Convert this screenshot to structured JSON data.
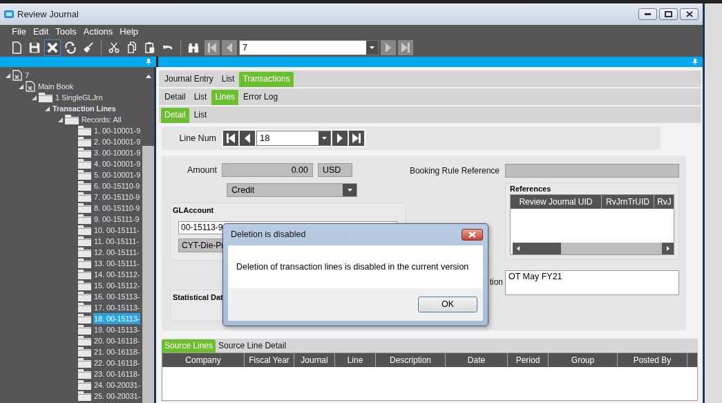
{
  "window": {
    "title": "Review Journal"
  },
  "menu": [
    "File",
    "Edit",
    "Tools",
    "Actions",
    "Help"
  ],
  "toolbar": {
    "buttons": [
      {
        "kind": "new",
        "highlighted": false
      },
      {
        "kind": "save",
        "highlighted": false
      },
      {
        "kind": "delete",
        "highlighted": true
      },
      {
        "kind": "refresh",
        "highlighted": false
      },
      {
        "kind": "clear",
        "highlighted": false
      },
      {
        "kind": "cut",
        "highlighted": false
      },
      {
        "kind": "copy",
        "highlighted": false
      },
      {
        "kind": "paste",
        "highlighted": false
      },
      {
        "kind": "undo",
        "highlighted": false
      },
      {
        "kind": "find",
        "highlighted": false
      }
    ],
    "record_nav": {
      "value": "7",
      "buttons": [
        {
          "kind": "first",
          "disabled": true
        },
        {
          "kind": "prev",
          "disabled": true
        },
        {
          "kind": "next",
          "disabled": true
        },
        {
          "kind": "last",
          "disabled": true
        }
      ]
    }
  },
  "tree": [
    {
      "label": "7",
      "kind": "document",
      "selected": false,
      "children": [
        {
          "label": "Main Book",
          "kind": "document",
          "selected": false,
          "children": [
            {
              "label": "1 SingleGLJrn",
              "kind": "folder",
              "selected": false,
              "children": [
                {
                  "label": "Transaction Lines",
                  "kind": "group",
                  "selected": false,
                  "children": [
                    {
                      "label": "Records: All",
                      "kind": "folder",
                      "selected": false,
                      "children": [
                        {
                          "label": "1. 00-10001-9",
                          "kind": "record",
                          "selected": false
                        },
                        {
                          "label": "2. 00-10001-9",
                          "kind": "record",
                          "selected": false
                        },
                        {
                          "label": "3. 00-10001-9",
                          "kind": "record",
                          "selected": false
                        },
                        {
                          "label": "4. 00-10001-9",
                          "kind": "record",
                          "selected": false
                        },
                        {
                          "label": "5. 00-10001-9",
                          "kind": "record",
                          "selected": false
                        },
                        {
                          "label": "6. 00-15110-9",
                          "kind": "record",
                          "selected": false
                        },
                        {
                          "label": "7. 00-15110-9",
                          "kind": "record",
                          "selected": false
                        },
                        {
                          "label": "8. 00-15110-9",
                          "kind": "record",
                          "selected": false
                        },
                        {
                          "label": "9. 00-15111-9",
                          "kind": "record",
                          "selected": false
                        },
                        {
                          "label": "10. 00-15111-",
                          "kind": "record",
                          "selected": false
                        },
                        {
                          "label": "11. 00-15111-",
                          "kind": "record",
                          "selected": false
                        },
                        {
                          "label": "12. 00-15111-",
                          "kind": "record",
                          "selected": false
                        },
                        {
                          "label": "13. 00-15111-",
                          "kind": "record",
                          "selected": false
                        },
                        {
                          "label": "14. 00-15112-",
                          "kind": "record",
                          "selected": false
                        },
                        {
                          "label": "15. 00-15112-",
                          "kind": "record",
                          "selected": false
                        },
                        {
                          "label": "16. 00-15113-",
                          "kind": "record",
                          "selected": false
                        },
                        {
                          "label": "17. 00-15113-",
                          "kind": "record",
                          "selected": false
                        },
                        {
                          "label": "18. 00-15113-",
                          "kind": "record",
                          "selected": true
                        },
                        {
                          "label": "19. 00-15113-",
                          "kind": "record",
                          "selected": false
                        },
                        {
                          "label": "20. 00-16118-",
                          "kind": "record",
                          "selected": false
                        },
                        {
                          "label": "21. 00-16118-",
                          "kind": "record",
                          "selected": false
                        },
                        {
                          "label": "22. 00-16118-",
                          "kind": "record",
                          "selected": false
                        },
                        {
                          "label": "23. 00-16118-",
                          "kind": "record",
                          "selected": false
                        },
                        {
                          "label": "24. 00-20031-",
                          "kind": "record",
                          "selected": false
                        },
                        {
                          "label": "25. 00-20031-",
                          "kind": "record",
                          "selected": false
                        }
                      ]
                    }
                  ]
                }
              ]
            }
          ]
        }
      ]
    }
  ],
  "tab_bars": [
    {
      "tabs": [
        {
          "label": "Journal Entry",
          "selected": false
        },
        {
          "label": "List",
          "selected": false
        },
        {
          "label": "Transactions",
          "selected": true
        }
      ]
    },
    {
      "tabs": [
        {
          "label": "Detail",
          "selected": false
        },
        {
          "label": "List",
          "selected": false
        },
        {
          "label": "Lines",
          "selected": true
        },
        {
          "label": "Error Log",
          "selected": false
        }
      ]
    },
    {
      "tabs": [
        {
          "label": "Detail",
          "selected": true
        },
        {
          "label": "List",
          "selected": false
        }
      ]
    }
  ],
  "line_num": {
    "label": "Line Num",
    "value": "18",
    "buttons": [
      {
        "kind": "first",
        "disabled": false
      },
      {
        "kind": "prev",
        "disabled": false
      },
      {
        "kind": "next",
        "disabled": false
      },
      {
        "kind": "last",
        "disabled": false
      }
    ]
  },
  "amount": {
    "label": "Amount",
    "value": "0.00",
    "currency": "USD"
  },
  "debit_credit": {
    "value": "Credit"
  },
  "gl_account": {
    "title": "GLAccount",
    "value": "00-15113-9",
    "description": "CYT-Die-Pr"
  },
  "statistical_data": {
    "title": "Statistical Dat"
  },
  "booking_rule_reference": {
    "label": "Booking Rule Reference"
  },
  "references": {
    "title": "References",
    "columns": [
      "Review Journal UID",
      "RvJrnTrUID",
      "RvJ"
    ]
  },
  "description": {
    "label": "tion",
    "value": "OT May FY21"
  },
  "source_tabs": [
    {
      "label": "Source Lines",
      "selected": true
    },
    {
      "label": "Source Line Detail",
      "selected": false
    }
  ],
  "source_lines": {
    "columns": [
      "Company",
      "Fiscal Year",
      "Journal",
      "Line",
      "Description",
      "Date",
      "Period",
      "Group",
      "Posted By"
    ]
  },
  "dialog": {
    "title": "Deletion is disabled",
    "message": "Deletion of transaction lines is disabled in the current version",
    "button": "OK"
  }
}
